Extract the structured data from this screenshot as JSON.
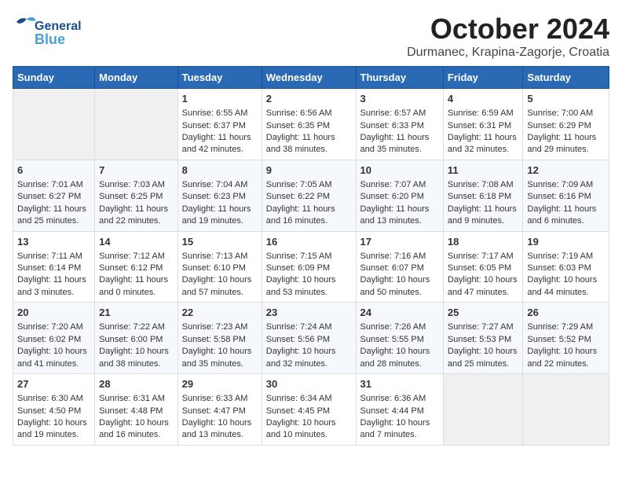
{
  "header": {
    "logo_general": "General",
    "logo_blue": "Blue",
    "month": "October 2024",
    "location": "Durmanec, Krapina-Zagorje, Croatia"
  },
  "days_of_week": [
    "Sunday",
    "Monday",
    "Tuesday",
    "Wednesday",
    "Thursday",
    "Friday",
    "Saturday"
  ],
  "weeks": [
    [
      {
        "day": "",
        "empty": true
      },
      {
        "day": "",
        "empty": true
      },
      {
        "day": "1",
        "sunrise": "6:55 AM",
        "sunset": "6:37 PM",
        "daylight": "11 hours and 42 minutes."
      },
      {
        "day": "2",
        "sunrise": "6:56 AM",
        "sunset": "6:35 PM",
        "daylight": "11 hours and 38 minutes."
      },
      {
        "day": "3",
        "sunrise": "6:57 AM",
        "sunset": "6:33 PM",
        "daylight": "11 hours and 35 minutes."
      },
      {
        "day": "4",
        "sunrise": "6:59 AM",
        "sunset": "6:31 PM",
        "daylight": "11 hours and 32 minutes."
      },
      {
        "day": "5",
        "sunrise": "7:00 AM",
        "sunset": "6:29 PM",
        "daylight": "11 hours and 29 minutes."
      }
    ],
    [
      {
        "day": "6",
        "sunrise": "7:01 AM",
        "sunset": "6:27 PM",
        "daylight": "11 hours and 25 minutes."
      },
      {
        "day": "7",
        "sunrise": "7:03 AM",
        "sunset": "6:25 PM",
        "daylight": "11 hours and 22 minutes."
      },
      {
        "day": "8",
        "sunrise": "7:04 AM",
        "sunset": "6:23 PM",
        "daylight": "11 hours and 19 minutes."
      },
      {
        "day": "9",
        "sunrise": "7:05 AM",
        "sunset": "6:22 PM",
        "daylight": "11 hours and 16 minutes."
      },
      {
        "day": "10",
        "sunrise": "7:07 AM",
        "sunset": "6:20 PM",
        "daylight": "11 hours and 13 minutes."
      },
      {
        "day": "11",
        "sunrise": "7:08 AM",
        "sunset": "6:18 PM",
        "daylight": "11 hours and 9 minutes."
      },
      {
        "day": "12",
        "sunrise": "7:09 AM",
        "sunset": "6:16 PM",
        "daylight": "11 hours and 6 minutes."
      }
    ],
    [
      {
        "day": "13",
        "sunrise": "7:11 AM",
        "sunset": "6:14 PM",
        "daylight": "11 hours and 3 minutes."
      },
      {
        "day": "14",
        "sunrise": "7:12 AM",
        "sunset": "6:12 PM",
        "daylight": "11 hours and 0 minutes."
      },
      {
        "day": "15",
        "sunrise": "7:13 AM",
        "sunset": "6:10 PM",
        "daylight": "10 hours and 57 minutes."
      },
      {
        "day": "16",
        "sunrise": "7:15 AM",
        "sunset": "6:09 PM",
        "daylight": "10 hours and 53 minutes."
      },
      {
        "day": "17",
        "sunrise": "7:16 AM",
        "sunset": "6:07 PM",
        "daylight": "10 hours and 50 minutes."
      },
      {
        "day": "18",
        "sunrise": "7:17 AM",
        "sunset": "6:05 PM",
        "daylight": "10 hours and 47 minutes."
      },
      {
        "day": "19",
        "sunrise": "7:19 AM",
        "sunset": "6:03 PM",
        "daylight": "10 hours and 44 minutes."
      }
    ],
    [
      {
        "day": "20",
        "sunrise": "7:20 AM",
        "sunset": "6:02 PM",
        "daylight": "10 hours and 41 minutes."
      },
      {
        "day": "21",
        "sunrise": "7:22 AM",
        "sunset": "6:00 PM",
        "daylight": "10 hours and 38 minutes."
      },
      {
        "day": "22",
        "sunrise": "7:23 AM",
        "sunset": "5:58 PM",
        "daylight": "10 hours and 35 minutes."
      },
      {
        "day": "23",
        "sunrise": "7:24 AM",
        "sunset": "5:56 PM",
        "daylight": "10 hours and 32 minutes."
      },
      {
        "day": "24",
        "sunrise": "7:26 AM",
        "sunset": "5:55 PM",
        "daylight": "10 hours and 28 minutes."
      },
      {
        "day": "25",
        "sunrise": "7:27 AM",
        "sunset": "5:53 PM",
        "daylight": "10 hours and 25 minutes."
      },
      {
        "day": "26",
        "sunrise": "7:29 AM",
        "sunset": "5:52 PM",
        "daylight": "10 hours and 22 minutes."
      }
    ],
    [
      {
        "day": "27",
        "sunrise": "6:30 AM",
        "sunset": "4:50 PM",
        "daylight": "10 hours and 19 minutes."
      },
      {
        "day": "28",
        "sunrise": "6:31 AM",
        "sunset": "4:48 PM",
        "daylight": "10 hours and 16 minutes."
      },
      {
        "day": "29",
        "sunrise": "6:33 AM",
        "sunset": "4:47 PM",
        "daylight": "10 hours and 13 minutes."
      },
      {
        "day": "30",
        "sunrise": "6:34 AM",
        "sunset": "4:45 PM",
        "daylight": "10 hours and 10 minutes."
      },
      {
        "day": "31",
        "sunrise": "6:36 AM",
        "sunset": "4:44 PM",
        "daylight": "10 hours and 7 minutes."
      },
      {
        "day": "",
        "empty": true
      },
      {
        "day": "",
        "empty": true
      }
    ]
  ],
  "labels": {
    "sunrise": "Sunrise:",
    "sunset": "Sunset:",
    "daylight": "Daylight:"
  }
}
